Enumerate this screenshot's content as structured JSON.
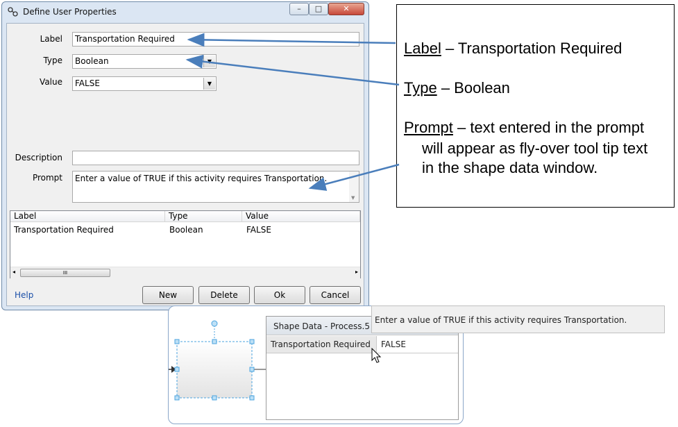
{
  "dialog": {
    "title": "Define User Properties",
    "title_icon": "properties-icon",
    "window_buttons": {
      "minimize": "–",
      "maximize": "□",
      "close": "✕"
    },
    "fields": {
      "label": {
        "caption": "Label",
        "value": "Transportation Required"
      },
      "type": {
        "caption": "Type",
        "value": "Boolean"
      },
      "value": {
        "caption": "Value",
        "value": "FALSE"
      },
      "description": {
        "caption": "Description",
        "value": ""
      },
      "prompt": {
        "caption": "Prompt",
        "value": "Enter a value of TRUE if this activity requires Transportation."
      }
    },
    "list": {
      "columns": [
        "Label",
        "Type",
        "Value"
      ],
      "rows": [
        {
          "label": "Transportation Required",
          "type": "Boolean",
          "value": "FALSE"
        }
      ],
      "scroll_thumb_glyph": "III"
    },
    "help_link": "Help",
    "buttons": {
      "new": "New",
      "delete": "Delete",
      "ok": "Ok",
      "cancel": "Cancel"
    }
  },
  "callout": {
    "label_term": "Label",
    "label_desc": " – Transportation Required",
    "type_term": "Type",
    "type_desc": " – Boolean",
    "prompt_term": "Prompt",
    "prompt_desc_line1": " – text entered in the prompt",
    "prompt_desc_line2": "will appear as fly-over tool tip text",
    "prompt_desc_line3": "in the shape data window."
  },
  "shape_data": {
    "window_title": "Shape Data - Process.5",
    "property_label": "Transportation Required",
    "property_value": "FALSE",
    "tooltip": "Enter a value of TRUE if this activity requires Transportation."
  },
  "colors": {
    "arrow": "#4a7ebb",
    "help_link": "#1a4fa8",
    "dialog_frame": "#dbe6f3",
    "selection_handle": "#4aa3df"
  }
}
